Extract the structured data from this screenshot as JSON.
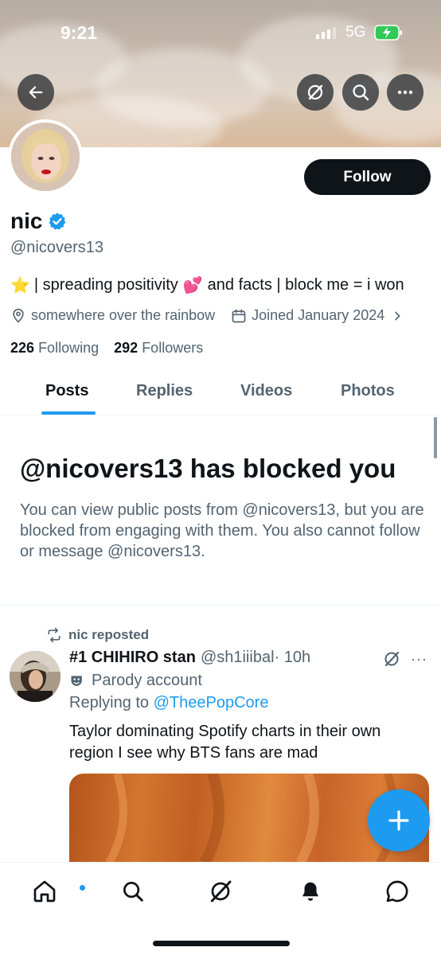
{
  "status_bar": {
    "time": "9:21",
    "network": "5G"
  },
  "profile": {
    "name": "nic",
    "handle": "@nicovers13",
    "follow_label": "Follow",
    "bio_before": "| spreading positivity",
    "bio_after": "and facts | block me = i won",
    "bio_emoji_star": "⭐",
    "bio_emoji_heart": "💕",
    "location": "somewhere over the rainbow",
    "joined": "Joined January 2024",
    "following_count": "226",
    "following_label": "Following",
    "followers_count": "292",
    "followers_label": "Followers"
  },
  "tabs": [
    {
      "label": "Posts",
      "active": true
    },
    {
      "label": "Replies",
      "active": false
    },
    {
      "label": "Videos",
      "active": false
    },
    {
      "label": "Photos",
      "active": false
    }
  ],
  "blocked": {
    "title": "@nicovers13 has blocked you",
    "message": "You can view public posts from @nicovers13, but you are blocked from engaging with them. You also cannot follow or message @nicovers13."
  },
  "post": {
    "repost_label": "nic reposted",
    "author": "#1 CHIHIRO stan",
    "handle": "@sh1iiibal",
    "time": "· 10h",
    "more": "···",
    "parody_label": "Parody account",
    "replying_prefix": "Replying to",
    "replying_handle": "@TheePopCore",
    "text": "Taylor dominating Spotify charts in their own region I see why BTS fans are mad"
  },
  "colors": {
    "accent": "#1d9bf0",
    "text": "#0f1419",
    "secondary": "#536471"
  },
  "icons": [
    "back-arrow-icon",
    "grok-icon",
    "search-icon",
    "more-icon",
    "verified-badge-icon",
    "location-icon",
    "calendar-icon",
    "chevron-right-icon",
    "repost-icon",
    "parody-mask-icon",
    "compose-plus-icon",
    "home-icon",
    "explore-icon",
    "grok-icon",
    "notifications-icon",
    "messages-icon"
  ]
}
